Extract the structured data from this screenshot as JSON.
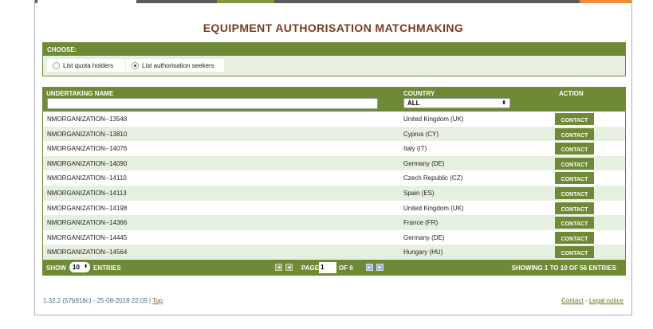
{
  "title": "EQUIPMENT AUTHORISATION MATCHMAKING",
  "choose": {
    "label": "CHOOSE:",
    "options": [
      {
        "label": "List quota holders",
        "checked": false
      },
      {
        "label": "List authorisation seekers",
        "checked": true
      }
    ]
  },
  "table": {
    "headers": {
      "name": "UNDERTAKING NAME",
      "country": "COUNTRY",
      "action": "ACTION"
    },
    "name_filter_value": "",
    "country_filter_value": "ALL",
    "contact_label": "CONTACT",
    "rows": [
      {
        "name": "NMORGANIZATION--13548",
        "country": "United Kingdom (UK)"
      },
      {
        "name": "NMORGANIZATION--13810",
        "country": "Cyprus (CY)"
      },
      {
        "name": "NMORGANIZATION--14076",
        "country": "Italy (IT)"
      },
      {
        "name": "NMORGANIZATION--14090",
        "country": "Germany (DE)"
      },
      {
        "name": "NMORGANIZATION--14110",
        "country": "Czech Republic (CZ)"
      },
      {
        "name": "NMORGANIZATION--14113",
        "country": "Spain (ES)"
      },
      {
        "name": "NMORGANIZATION--14198",
        "country": "United Kingdom (UK)"
      },
      {
        "name": "NMORGANIZATION--14366",
        "country": "France (FR)"
      },
      {
        "name": "NMORGANIZATION--14445",
        "country": "Germany (DE)"
      },
      {
        "name": "NMORGANIZATION--14564",
        "country": "Hungary (HU)"
      }
    ]
  },
  "pagination": {
    "show_label": "SHOW",
    "entries_per_page": "10",
    "entries_label": "ENTRIES",
    "page_label": "PAGE",
    "current_page": "1",
    "of_label": "OF 6",
    "summary": "SHOWING 1 TO 10 OF 56 ENTRIES"
  },
  "footer": {
    "version": "1.32.2 (57b918c) - 25-08-2018 22:09 |",
    "top_link": "Top",
    "contact_link": "Contact",
    "separator": "-",
    "legal_link": "Legal notice"
  },
  "colors": {
    "accent_green": "#6e8a36",
    "title_brown": "#7a3b1d",
    "row_alt": "#e6f0e0"
  }
}
